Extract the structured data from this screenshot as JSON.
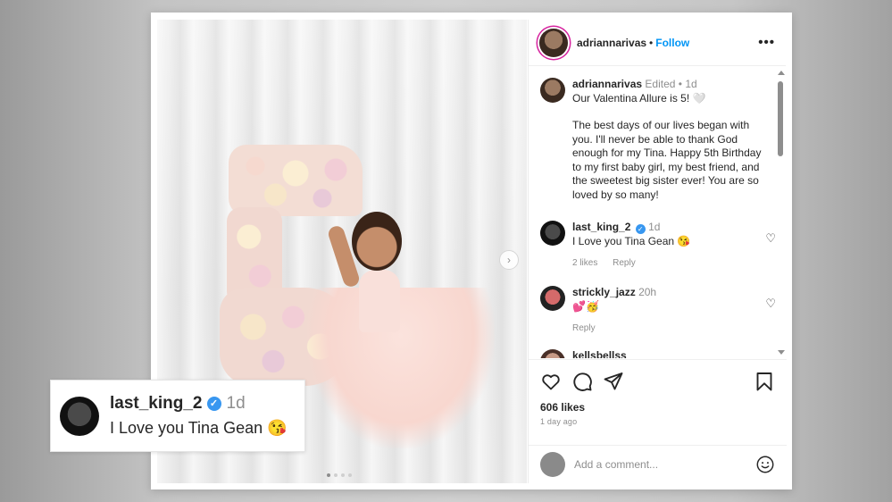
{
  "post": {
    "username": "adriannarivas",
    "follow_label": "Follow",
    "separator": "•",
    "more_label": "•••"
  },
  "caption": {
    "username": "adriannarivas",
    "edited": "Edited",
    "time": "1d",
    "line1": "Our Valentina Allure is 5! 🤍",
    "line2": "The best days of our lives began with you. I'll never be able to thank God enough for my Tina. Happy 5th Birthday to my first baby girl, my best friend, and the sweetest big sister ever! You are so loved by so many!"
  },
  "comments": [
    {
      "username": "last_king_2",
      "verified": true,
      "time": "1d",
      "text": "I Love you Tina Gean 😘",
      "likes": "2 likes",
      "reply": "Reply"
    },
    {
      "username": "strickly_jazz",
      "verified": false,
      "time": "20h",
      "text": "💕🥳",
      "likes": "",
      "reply": "Reply"
    },
    {
      "username": "kellsbellss",
      "verified": false,
      "time": "",
      "text": "",
      "likes": "",
      "reply": ""
    }
  ],
  "actions": {
    "likes_count": "606 likes",
    "posted_ago": "1 day ago",
    "add_comment_placeholder": "Add a comment..."
  },
  "carousel": {
    "next_glyph": "›",
    "total_slides": 4,
    "active_index": 0
  },
  "callout": {
    "username": "last_king_2",
    "time": "1d",
    "text": "I Love you Tina Gean 😘"
  },
  "colors": {
    "follow": "#0095f6",
    "verified": "#3897f0",
    "story_ring": "#d6249f"
  },
  "icons": [
    "heart-icon",
    "comment-icon",
    "share-icon",
    "bookmark-icon",
    "emoji-icon",
    "verified-icon",
    "chevron-right-icon"
  ]
}
